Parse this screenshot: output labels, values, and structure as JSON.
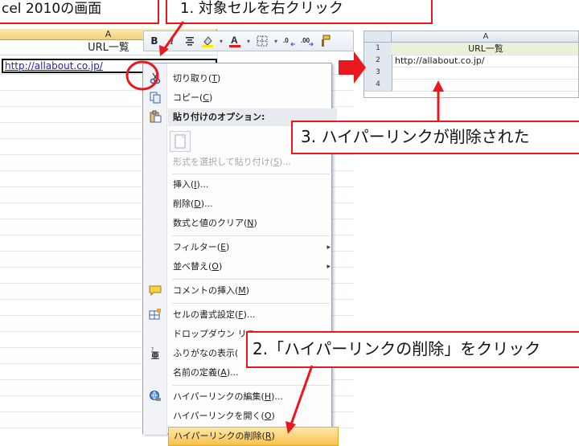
{
  "callouts": {
    "title": "cel 2010の画面",
    "step1": "1. 対象セルを右クリック",
    "step2": "2.「ハイパーリンクの削除」をクリック",
    "step3": "3. ハイパーリンクが削除された"
  },
  "left_sheet": {
    "column_header": "A",
    "row1_value": "URL一覧",
    "cell_a2_value": "http://allabout.co.jp/"
  },
  "right_sheet": {
    "column_header": "A",
    "row_numbers": [
      "1",
      "2",
      "3",
      "4"
    ],
    "row1_value": "URL一覧",
    "row2_value": "http://allabout.co.jp/"
  },
  "mini_toolbar": {
    "bold": "B",
    "italic": "I",
    "icons": [
      "bold-icon",
      "italic-icon",
      "center-align-icon",
      "fill-color-icon",
      "font-color-icon",
      "borders-icon",
      "increase-decimal-icon",
      "decrease-decimal-icon",
      "format-painter-icon"
    ]
  },
  "context_menu": {
    "items": [
      {
        "label": "切り取り(",
        "accel": "T",
        "tail": ")",
        "icon": "scissors-icon"
      },
      {
        "label": "コピー(",
        "accel": "C",
        "tail": ")",
        "icon": "copy-icon"
      },
      {
        "label": "貼り付けのオプション:",
        "accel": "",
        "tail": "",
        "icon": "paste-icon"
      },
      {
        "label": "形式を選択して貼り付け(",
        "accel": "S",
        "tail": ")...",
        "icon": ""
      },
      {
        "label": "挿入(",
        "accel": "I",
        "tail": ")...",
        "icon": ""
      },
      {
        "label": "削除(",
        "accel": "D",
        "tail": ")...",
        "icon": ""
      },
      {
        "label": "数式と値のクリア(",
        "accel": "N",
        "tail": ")",
        "icon": ""
      },
      {
        "label": "フィルター(",
        "accel": "E",
        "tail": ")",
        "icon": ""
      },
      {
        "label": "並べ替え(",
        "accel": "O",
        "tail": ")",
        "icon": ""
      },
      {
        "label": "コメントの挿入(",
        "accel": "M",
        "tail": ")",
        "icon": "comment-icon"
      },
      {
        "label": "セルの書式設定(",
        "accel": "F",
        "tail": ")...",
        "icon": "format-cells-icon"
      },
      {
        "label": "ドロップダウン リス",
        "accel": "",
        "tail": "",
        "icon": ""
      },
      {
        "label": "ふりがなの表示(",
        "accel": "",
        "tail": "",
        "icon": "furigana-icon"
      },
      {
        "label": "名前の定義(",
        "accel": "A",
        "tail": ")...",
        "icon": ""
      },
      {
        "label": "ハイパーリンクの編集(",
        "accel": "H",
        "tail": ")...",
        "icon": "hyperlink-edit-icon"
      },
      {
        "label": "ハイパーリンクを開く(",
        "accel": "O",
        "tail": ")",
        "icon": ""
      },
      {
        "label": "ハイパーリンクの削除(",
        "accel": "R",
        "tail": ")",
        "icon": ""
      }
    ],
    "submenu_arrow": "▸"
  },
  "colors": {
    "callout_border": "#e8181d",
    "arrow": "#e8181d",
    "highlight": "#f6c24e",
    "link": "#1f1fbf"
  }
}
